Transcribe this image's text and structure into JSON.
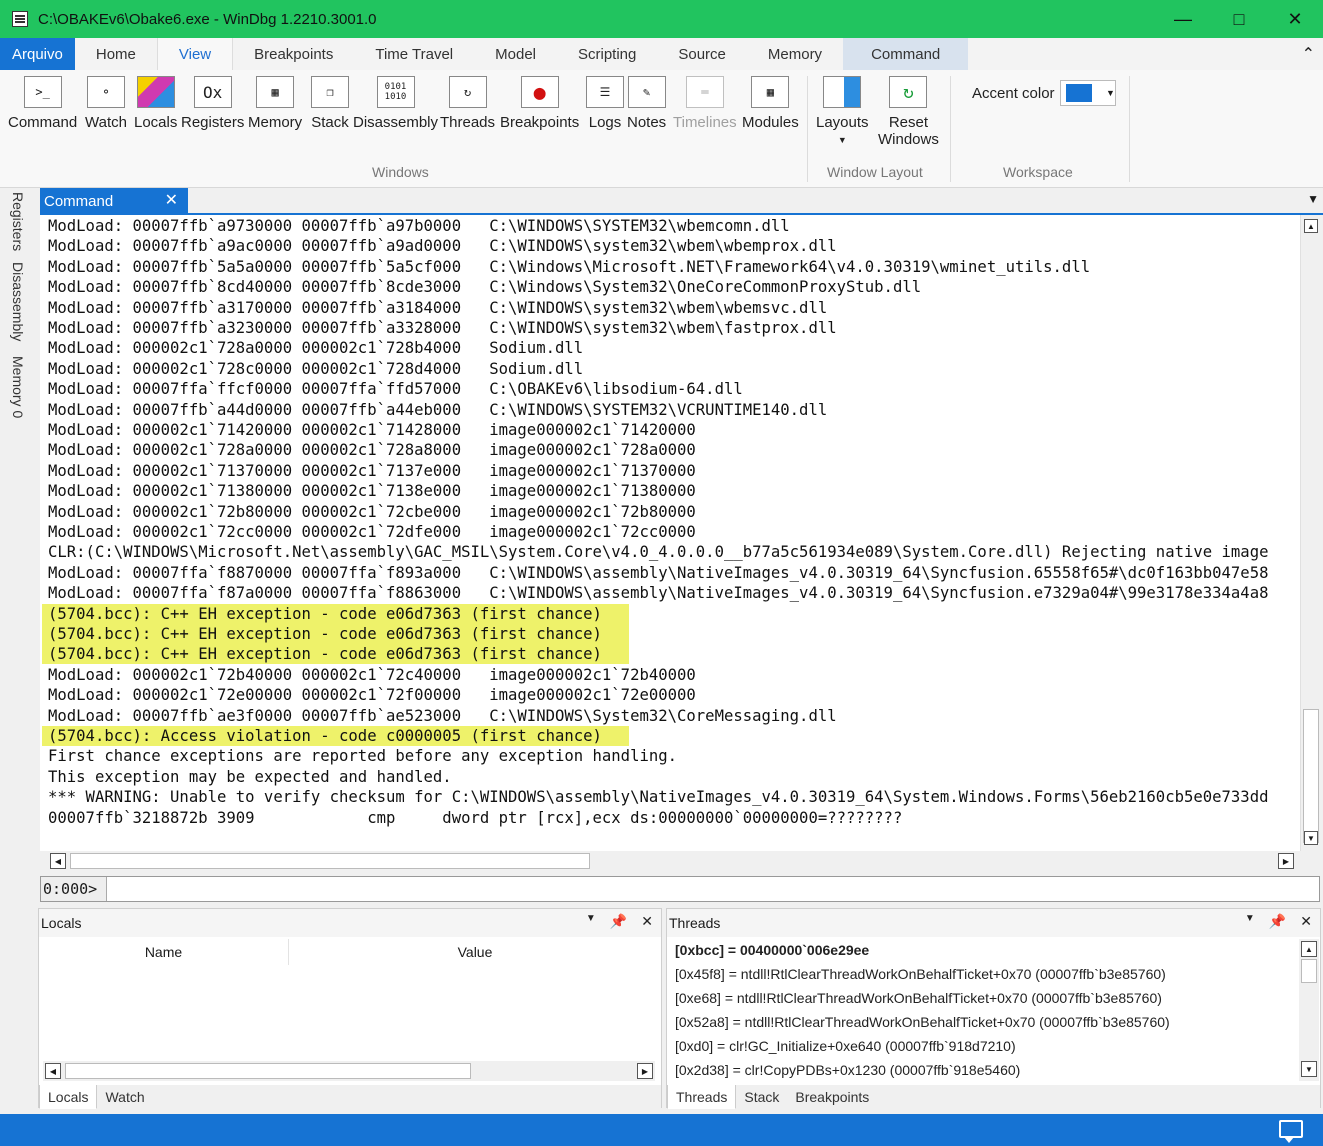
{
  "window": {
    "title": "C:\\OBAKEv6\\Obake6.exe  - WinDbg 1.2210.3001.0"
  },
  "menu": {
    "file": "Arquivo",
    "tabs": [
      "Home",
      "View",
      "Breakpoints",
      "Time Travel",
      "Model",
      "Scripting",
      "Source",
      "Memory",
      "Command"
    ],
    "active": "View",
    "highlighted": "Command"
  },
  "ribbon": {
    "windows_buttons": [
      {
        "label": "Command",
        "icon": "command-prompt-icon"
      },
      {
        "label": "Watch",
        "icon": "watch-glasses-icon"
      },
      {
        "label": "Locals",
        "icon": "locals-icon"
      },
      {
        "label": "Registers",
        "icon": "registers-icon"
      },
      {
        "label": "Memory",
        "icon": "memory-chip-icon"
      },
      {
        "label": "Stack",
        "icon": "stack-icon"
      },
      {
        "label": "Disassembly",
        "icon": "disassembly-icon"
      },
      {
        "label": "Threads",
        "icon": "threads-icon"
      },
      {
        "label": "Breakpoints",
        "icon": "breakpoint-icon"
      },
      {
        "label": "Logs",
        "icon": "logs-icon"
      },
      {
        "label": "Notes",
        "icon": "notes-icon"
      },
      {
        "label": "Timelines",
        "icon": "timelines-icon"
      },
      {
        "label": "Modules",
        "icon": "modules-icon"
      }
    ],
    "windows_group": "Windows",
    "layouts_label": "Layouts",
    "reset_label_1": "Reset",
    "reset_label_2": "Windows",
    "window_layout_group": "Window Layout",
    "accent_color_label": "Accent color",
    "accent_color": "#1673d3",
    "workspace_group": "Workspace"
  },
  "side_tabs": [
    "Registers",
    "Disassembly",
    "Memory 0"
  ],
  "command_window": {
    "tab_label": "Command",
    "lines": [
      "ModLoad: 00007ffb`a9730000 00007ffb`a97b0000   C:\\WINDOWS\\SYSTEM32\\wbemcomn.dll",
      "ModLoad: 00007ffb`a9ac0000 00007ffb`a9ad0000   C:\\WINDOWS\\system32\\wbem\\wbemprox.dll",
      "ModLoad: 00007ffb`5a5a0000 00007ffb`5a5cf000   C:\\Windows\\Microsoft.NET\\Framework64\\v4.0.30319\\wminet_utils.dll",
      "ModLoad: 00007ffb`8cd40000 00007ffb`8cde3000   C:\\Windows\\System32\\OneCoreCommonProxyStub.dll",
      "ModLoad: 00007ffb`a3170000 00007ffb`a3184000   C:\\WINDOWS\\system32\\wbem\\wbemsvc.dll",
      "ModLoad: 00007ffb`a3230000 00007ffb`a3328000   C:\\WINDOWS\\system32\\wbem\\fastprox.dll",
      "ModLoad: 000002c1`728a0000 000002c1`728b4000   Sodium.dll",
      "ModLoad: 000002c1`728c0000 000002c1`728d4000   Sodium.dll",
      "ModLoad: 00007ffa`ffcf0000 00007ffa`ffd57000   C:\\OBAKEv6\\libsodium-64.dll",
      "ModLoad: 00007ffb`a44d0000 00007ffb`a44eb000   C:\\WINDOWS\\SYSTEM32\\VCRUNTIME140.dll",
      "ModLoad: 000002c1`71420000 000002c1`71428000   image000002c1`71420000",
      "ModLoad: 000002c1`728a0000 000002c1`728a8000   image000002c1`728a0000",
      "ModLoad: 000002c1`71370000 000002c1`7137e000   image000002c1`71370000",
      "ModLoad: 000002c1`71380000 000002c1`7138e000   image000002c1`71380000",
      "ModLoad: 000002c1`72b80000 000002c1`72cbe000   image000002c1`72b80000",
      "ModLoad: 000002c1`72cc0000 000002c1`72dfe000   image000002c1`72cc0000",
      "CLR:(C:\\WINDOWS\\Microsoft.Net\\assembly\\GAC_MSIL\\System.Core\\v4.0_4.0.0.0__b77a5c561934e089\\System.Core.dll) Rejecting native image",
      "ModLoad: 00007ffa`f8870000 00007ffa`f893a000   C:\\WINDOWS\\assembly\\NativeImages_v4.0.30319_64\\Syncfusion.65558f65#\\dc0f163bb047e58",
      "ModLoad: 00007ffa`f87a0000 00007ffa`f8863000   C:\\WINDOWS\\assembly\\NativeImages_v4.0.30319_64\\Syncfusion.e7329a04#\\99e3178e334a4a8",
      "(5704.bcc): C++ EH exception - code e06d7363 (first chance)",
      "(5704.bcc): C++ EH exception - code e06d7363 (first chance)",
      "(5704.bcc): C++ EH exception - code e06d7363 (first chance)",
      "ModLoad: 000002c1`72b40000 000002c1`72c40000   image000002c1`72b40000",
      "ModLoad: 000002c1`72e00000 000002c1`72f00000   image000002c1`72e00000",
      "ModLoad: 00007ffb`ae3f0000 00007ffb`ae523000   C:\\WINDOWS\\System32\\CoreMessaging.dll",
      "(5704.bcc): Access violation - code c0000005 (first chance)",
      "First chance exceptions are reported before any exception handling.",
      "This exception may be expected and handled.",
      "*** WARNING: Unable to verify checksum for C:\\WINDOWS\\assembly\\NativeImages_v4.0.30319_64\\System.Windows.Forms\\56eb2160cb5e0e733dd",
      "00007ffb`3218872b 3909            cmp     dword ptr [rcx],ecx ds:00000000`00000000=????????"
    ],
    "highlight_color": "#eef26a",
    "prompt": "0:000>",
    "input_value": ""
  },
  "locals_panel": {
    "title": "Locals",
    "col_name": "Name",
    "col_value": "Value",
    "tabs": [
      "Locals",
      "Watch"
    ]
  },
  "threads_panel": {
    "title": "Threads",
    "rows": [
      "[0xbcc] = 00400000`006e29ee",
      "[0x45f8] = ntdll!RtlClearThreadWorkOnBehalfTicket+0x70 (00007ffb`b3e85760)",
      "[0xe68] = ntdll!RtlClearThreadWorkOnBehalfTicket+0x70 (00007ffb`b3e85760)",
      "[0x52a8] = ntdll!RtlClearThreadWorkOnBehalfTicket+0x70 (00007ffb`b3e85760)",
      "[0xd0] = clr!GC_Initialize+0xe640 (00007ffb`918d7210)",
      "[0x2d38] = clr!CopyPDBs+0x1230 (00007ffb`918e5460)"
    ],
    "tabs": [
      "Threads",
      "Stack",
      "Breakpoints"
    ]
  },
  "status_bar": {
    "color": "#1673d3",
    "icon": "message-icon"
  }
}
